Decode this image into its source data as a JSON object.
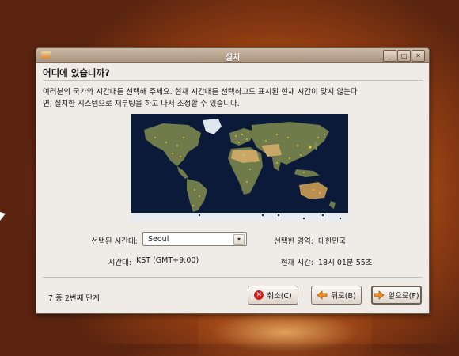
{
  "window": {
    "title": "설치",
    "controls": {
      "minimize": "_",
      "maximize": "□",
      "close": "✕"
    }
  },
  "page": {
    "heading": "어디에 있습니까?",
    "description_line1": "여러분의 국가와 시간대를 선택해 주세요. 현재 시간대를 선택하고도 표시된 현재 시간이 맞지 않는다",
    "description_line2": "면, 설치한 시스템으로 재부팅을 하고 나서 조정할 수 있습니다."
  },
  "timezone": {
    "selected_label": "선택된 시간대:",
    "selected_value": "Seoul",
    "tz_label": "시간대:",
    "tz_value": "KST (GMT+9:00)",
    "region_label": "선택한 영역:",
    "region_value": "대한민국",
    "time_label": "현재 시간:",
    "time_value": "18시 01분 55초"
  },
  "footer": {
    "step": "7 중 2번째 단계",
    "cancel": "취소(C)",
    "back": "뒤로(B)",
    "forward": "앞으로(F)"
  },
  "colors": {
    "ocean": "#0c1a3a",
    "land": "#6f7b4a",
    "desert": "#c9a766",
    "ice": "#e6ecf2",
    "city_dot": "#ffcc33",
    "cancel_icon": "#d01f1f",
    "arrow_icon": "#f2901e"
  },
  "icons": {
    "app": "installer-icon",
    "cancel": "stop-icon",
    "back": "arrow-left-icon",
    "forward": "arrow-right-icon"
  }
}
